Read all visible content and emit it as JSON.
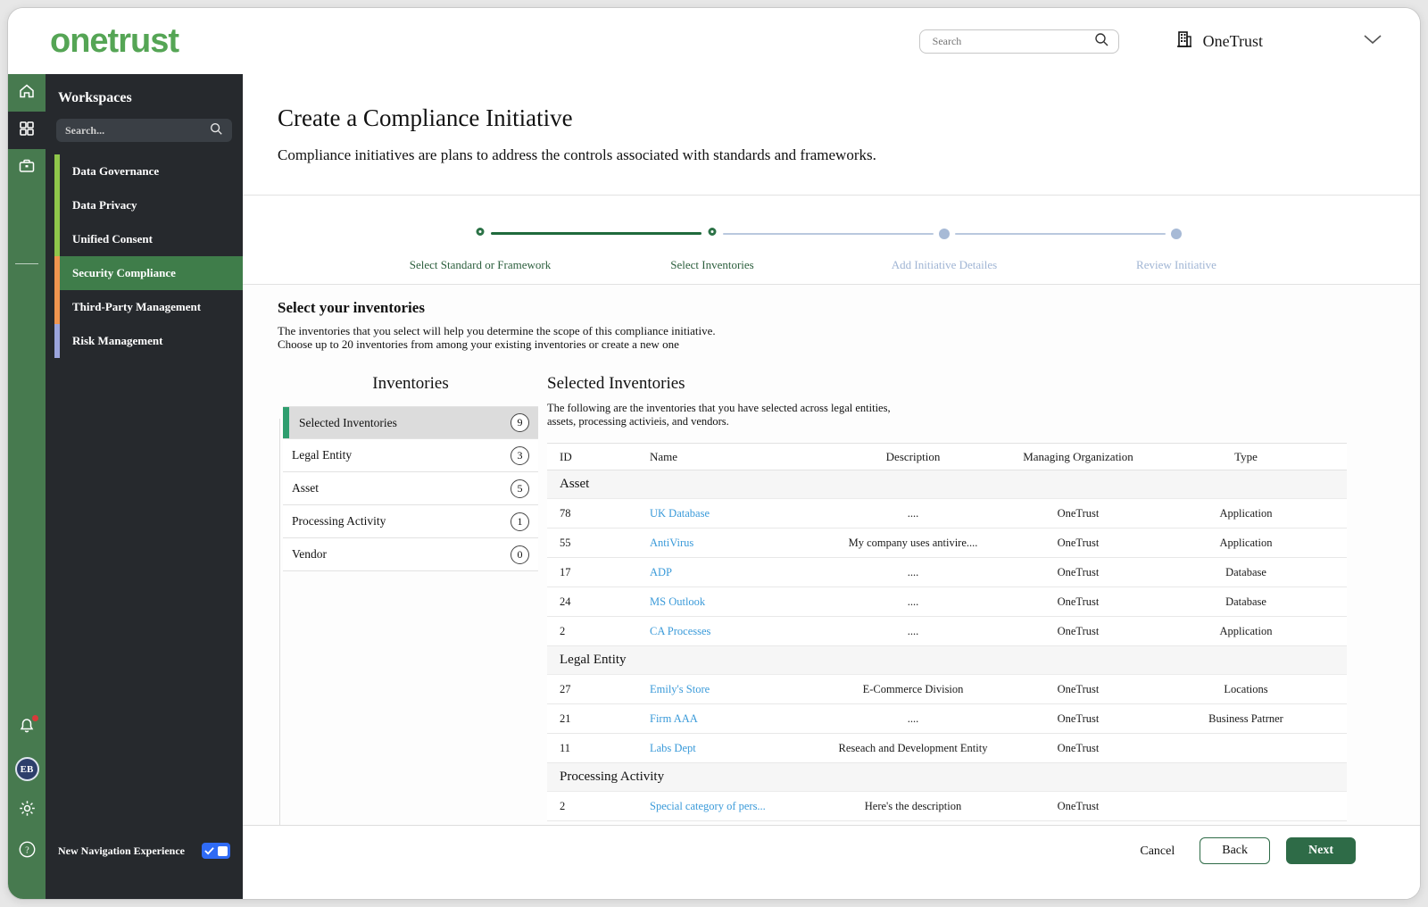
{
  "header": {
    "logo": "onetrust",
    "search_placeholder": "Search",
    "tenant_name": "OneTrust"
  },
  "sidebar": {
    "title": "Workspaces",
    "search_placeholder": "Search...",
    "items": [
      {
        "label": "Data Governance",
        "accent": "#8fc64a",
        "active": false
      },
      {
        "label": "Data Privacy",
        "accent": "#8fc64a",
        "active": false
      },
      {
        "label": "Unified Consent",
        "accent": "#8fc64a",
        "active": false
      },
      {
        "label": "Security Compliance",
        "accent": "#f0954f",
        "active": true
      },
      {
        "label": "Third-Party Management",
        "accent": "#f0954f",
        "active": false
      },
      {
        "label": "Risk Management",
        "accent": "#9ba4dc",
        "active": false
      }
    ],
    "footer_toggle_label": "New Navigation Experience",
    "avatar_initials": "EB"
  },
  "page": {
    "title": "Create a Compliance Initiative",
    "subtitle": "Compliance initiatives are plans to address the controls associated with standards and frameworks.",
    "steps": [
      {
        "label": "Select Standard or Framework",
        "state": "done"
      },
      {
        "label": "Select Inventories",
        "state": "done"
      },
      {
        "label": "Add Initiative Detailes",
        "state": "todo"
      },
      {
        "label": "Review Initiative",
        "state": "todo"
      }
    ],
    "section": {
      "heading": "Select your inventories",
      "desc_line1": "The inventories that you select will help you determine the scope of this compliance initiative.",
      "desc_line2": "Choose up to 20 inventories from among your existing inventories or create a new one"
    },
    "inventories_panel": {
      "title": "Inventories",
      "items": [
        {
          "label": "Selected Inventories",
          "count": "9",
          "selected": true
        },
        {
          "label": "Legal Entity",
          "count": "3",
          "selected": false
        },
        {
          "label": "Asset",
          "count": "5",
          "selected": false
        },
        {
          "label": "Processing Activity",
          "count": "1",
          "selected": false
        },
        {
          "label": "Vendor",
          "count": "0",
          "selected": false
        }
      ]
    },
    "selected_panel": {
      "title": "Selected Inventories",
      "desc_line1": "The following are the inventories that you have selected across legal entities,",
      "desc_line2": "assets, processing activieis, and vendors.",
      "columns": [
        "ID",
        "Name",
        "Description",
        "Managing Organization",
        "Type"
      ],
      "groups": [
        {
          "name": "Asset",
          "rows": [
            {
              "id": "78",
              "name": "UK Database",
              "description": "....",
              "org": "OneTrust",
              "type": "Application"
            },
            {
              "id": "55",
              "name": "AntiVirus",
              "description": "My company uses antivire....",
              "org": "OneTrust",
              "type": "Application"
            },
            {
              "id": "17",
              "name": "ADP",
              "description": "....",
              "org": "OneTrust",
              "type": "Database"
            },
            {
              "id": "24",
              "name": "MS Outlook",
              "description": "....",
              "org": "OneTrust",
              "type": "Database"
            },
            {
              "id": "2",
              "name": "CA Processes",
              "description": "....",
              "org": "OneTrust",
              "type": "Application"
            }
          ]
        },
        {
          "name": "Legal Entity",
          "rows": [
            {
              "id": "27",
              "name": "Emily's Store",
              "description": "E-Commerce Division",
              "org": "OneTrust",
              "type": "Locations"
            },
            {
              "id": "21",
              "name": "Firm AAA",
              "description": "....",
              "org": "OneTrust",
              "type": "Business Patrner"
            },
            {
              "id": "11",
              "name": "Labs Dept",
              "description": "Reseach and Development Entity",
              "org": "OneTrust",
              "type": ""
            }
          ]
        },
        {
          "name": "Processing Activity",
          "rows": [
            {
              "id": "2",
              "name": "Special category of pers...",
              "description": "Here's the description",
              "org": "OneTrust",
              "type": ""
            }
          ]
        }
      ]
    },
    "footer": {
      "cancel_label": "Cancel",
      "back_label": "Back",
      "next_label": "Next"
    }
  },
  "colors": {
    "brand_green": "#55a555",
    "rail_green": "#477a4f",
    "sidebar_dark": "#26292d",
    "active_item_green": "#3f7d4a",
    "selected_bar_green": "#2f9e6f",
    "stepper_done_green": "#1f6a3c",
    "stepper_todo_blue": "#a7bad6",
    "link_blue": "#3a9ad9",
    "toggle_blue": "#2f6bf5",
    "next_button_green": "#2e6b47"
  }
}
